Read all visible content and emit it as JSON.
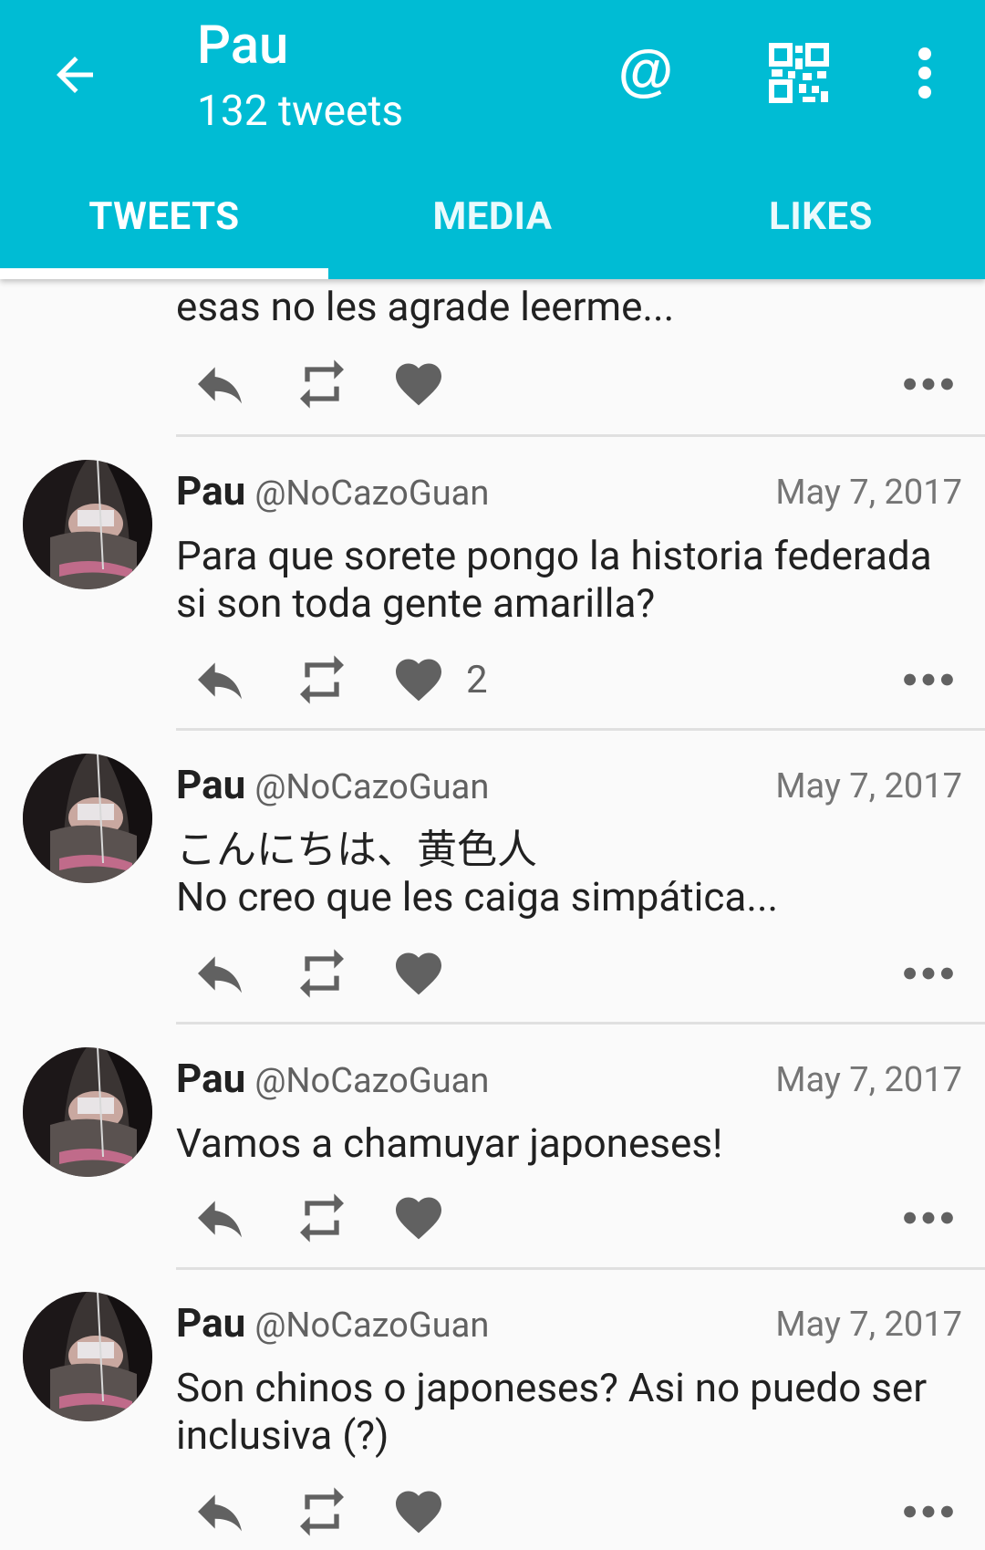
{
  "appbar": {
    "title": "Pau",
    "subtitle": "132 tweets",
    "icons": [
      "back-arrow-icon",
      "at-sign-icon",
      "qr-code-icon",
      "overflow-menu-icon"
    ],
    "color": "#00bcd4"
  },
  "tabs": [
    {
      "label": "TWEETS",
      "active": true
    },
    {
      "label": "MEDIA",
      "active": false
    },
    {
      "label": "LIKES",
      "active": false
    }
  ],
  "partial_tweet": {
    "text": "esas no les agrade leerme..."
  },
  "tweets": [
    {
      "name": "Pau",
      "handle": "@NoCazoGuan",
      "date": "May 7, 2017",
      "text": "Para que sorete pongo la historia federada\nsi son toda gente amarilla?",
      "likes": "2"
    },
    {
      "name": "Pau",
      "handle": "@NoCazoGuan",
      "date": "May 7, 2017",
      "text": "こんにちは、黄色人\nNo creo que les caiga simpática...",
      "likes": ""
    },
    {
      "name": "Pau",
      "handle": "@NoCazoGuan",
      "date": "May 7, 2017",
      "text": "Vamos a chamuyar japoneses!",
      "likes": ""
    },
    {
      "name": "Pau",
      "handle": "@NoCazoGuan",
      "date": "May 7, 2017",
      "text": "Son chinos o japoneses? Asi no puedo ser\ninclusiva (?)",
      "likes": ""
    }
  ]
}
